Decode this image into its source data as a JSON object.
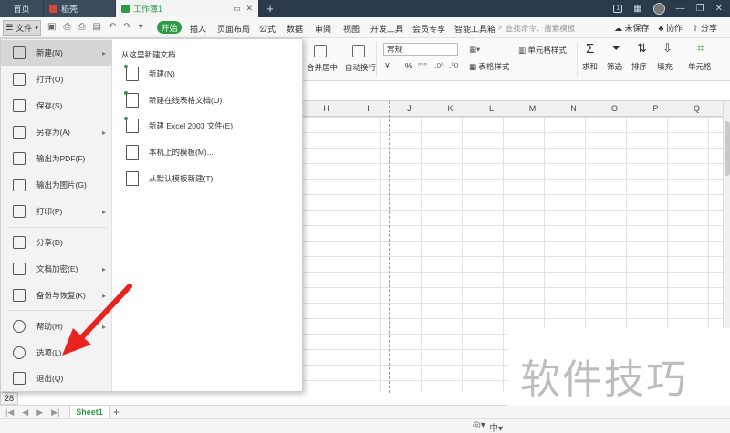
{
  "titlebar": {
    "tabs": [
      {
        "label": "首页"
      },
      {
        "label": "稻壳"
      },
      {
        "label": "工作簿1"
      }
    ],
    "new_tab": "+"
  },
  "menubar": {
    "file_label": "文件",
    "start_label": "开始",
    "items": [
      "插入",
      "页面布局",
      "公式",
      "数据",
      "审阅",
      "视图",
      "开发工具",
      "会员专享",
      "智能工具箱"
    ],
    "search_placeholder": "查找命令、搜索模板",
    "unsaved": "未保存",
    "collab": "协作",
    "share": "分享"
  },
  "ribbon": {
    "merge_center": "合并居中",
    "wrap_text": "自动换行",
    "number_format": "常规",
    "currency": "¥",
    "percent": "%",
    "table_style": "表格样式",
    "cell_style": "单元格样式",
    "sum": "求和",
    "filter": "筛选",
    "sort": "排序",
    "fill": "填充",
    "cell": "单元格"
  },
  "grid": {
    "columns": [
      "H",
      "I",
      "J",
      "K",
      "L",
      "M",
      "N",
      "O",
      "P",
      "Q"
    ],
    "row_number": "28"
  },
  "sheets": {
    "tabs": [
      "Sheet1"
    ],
    "add": "+"
  },
  "file_menu": {
    "left_items": [
      {
        "label": "新建(N)",
        "icon": "new-file-icon"
      },
      {
        "label": "打开(O)",
        "icon": "folder-icon"
      },
      {
        "label": "保存(S)",
        "icon": "save-icon"
      },
      {
        "label": "另存为(A)",
        "icon": "save-as-icon"
      },
      {
        "label": "输出为PDF(F)",
        "icon": "pdf-icon"
      },
      {
        "label": "输出为图片(G)",
        "icon": "image-icon"
      },
      {
        "label": "打印(P)",
        "icon": "printer-icon"
      },
      {
        "label": "分享(D)",
        "icon": "share-icon"
      },
      {
        "label": "文档加密(E)",
        "icon": "lock-icon"
      },
      {
        "label": "备份与恢复(K)",
        "icon": "backup-icon"
      },
      {
        "label": "帮助(H)",
        "icon": "help-icon"
      },
      {
        "label": "选项(L)",
        "icon": "gear-icon"
      },
      {
        "label": "退出(Q)",
        "icon": "exit-icon"
      }
    ],
    "right_title": "从这里新建文档",
    "right_items": [
      {
        "label": "新建(N)",
        "icon": "new-sheet-icon"
      },
      {
        "label": "新建在线表格文档(O)",
        "icon": "online-sheet-icon"
      },
      {
        "label": "新建 Excel 2003 文件(E)",
        "icon": "excel-2003-icon"
      },
      {
        "label": "本机上的模板(M)...",
        "icon": "local-template-icon"
      },
      {
        "label": "从默认模板新建(T)",
        "icon": "default-template-icon"
      }
    ]
  },
  "annotation": {
    "arrow_color": "#e8231f"
  },
  "watermark": {
    "text": "软件技巧"
  },
  "colors": {
    "accent": "#2d9a45",
    "titlebar": "#2b3a4a"
  }
}
